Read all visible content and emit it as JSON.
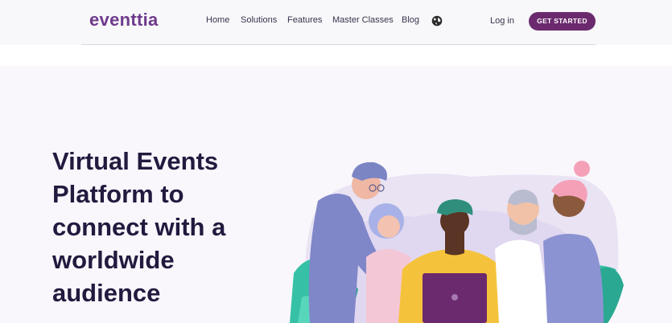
{
  "brand": {
    "logo_text": "eventtia"
  },
  "nav": {
    "items": [
      {
        "label": "Home"
      },
      {
        "label": "Solutions"
      },
      {
        "label": "Features"
      },
      {
        "label": "Master Classes"
      },
      {
        "label": "Blog"
      }
    ],
    "globe_icon": "globe-icon",
    "login_label": "Log in",
    "cta_label": "GET STARTED"
  },
  "hero": {
    "headline_lines": [
      "Virtual Events",
      "Platform to",
      "connect with a",
      "worldwide",
      "audience"
    ],
    "illustration": "people-around-laptop-illustration"
  },
  "colors": {
    "brand_purple": "#6e3a8c",
    "cta_bg": "#6b2a6e",
    "headline": "#231a3f"
  }
}
